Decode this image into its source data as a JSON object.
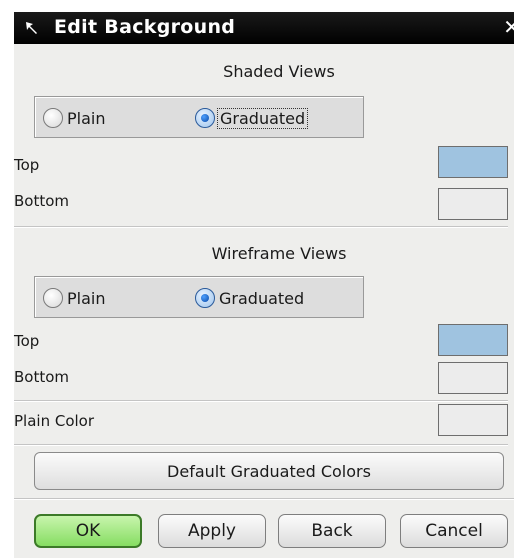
{
  "dialog": {
    "title": "Edit Background",
    "close_glyph": "✕"
  },
  "shaded": {
    "heading": "Shaded Views",
    "options": [
      "Plain",
      "Graduated"
    ],
    "selected": "Graduated",
    "top_label": "Top",
    "bottom_label": "Bottom",
    "top_color": "#9fc3e0",
    "bottom_color": "#ececec"
  },
  "wireframe": {
    "heading": "Wireframe Views",
    "options": [
      "Plain",
      "Graduated"
    ],
    "selected": "Graduated",
    "top_label": "Top",
    "bottom_label": "Bottom",
    "top_color": "#9fc3e0",
    "bottom_color": "#ececec"
  },
  "plain": {
    "label": "Plain Color",
    "color": "#ececec"
  },
  "default_button": "Default Graduated Colors",
  "footer": {
    "ok": "OK",
    "apply": "Apply",
    "back": "Back",
    "cancel": "Cancel"
  },
  "icons": {
    "title": "pin-icon",
    "close": "close-icon"
  }
}
